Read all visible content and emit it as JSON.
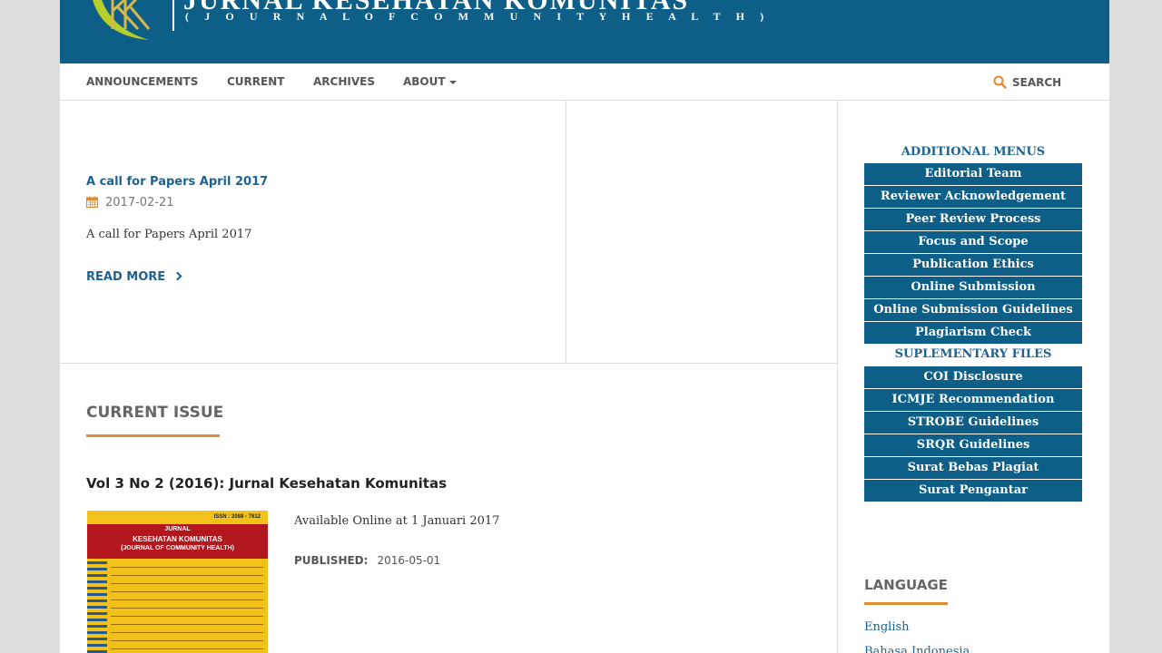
{
  "header": {
    "title": "JURNAL KESEHATAN KOMUNITAS",
    "subtitle": "( J O U R N A L   O F   C O M M U N I T Y   H E A L T H )"
  },
  "nav": {
    "announcements": "ANNOUNCEMENTS",
    "current": "CURRENT",
    "archives": "ARCHIVES",
    "about": "ABOUT",
    "search": "SEARCH"
  },
  "announcement": {
    "title": "A call for Papers April 2017",
    "date": "2017-02-21",
    "summary": "A call for Papers April 2017",
    "read_more": "READ MORE"
  },
  "current_issue": {
    "heading": "CURRENT ISSUE",
    "title": "Vol 3 No 2 (2016): Jurnal Kesehatan Komunitas",
    "description": "Available Online at 1 Januari 2017",
    "published_label": "PUBLISHED:",
    "published_date": "2016-05-01",
    "cover": {
      "issn": "ISSN : 2088 - 7612",
      "line1": "JURNAL",
      "line2": "KESEHATAN KOMUNITAS",
      "line3": "(JOURNAL OF COMMUNITY HEALTH)"
    }
  },
  "sidebar": {
    "additional_heading": "ADDITIONAL MENUS",
    "additional": [
      "Editorial Team",
      "Reviewer Acknowledgement",
      "Peer Review Process",
      "Focus and Scope",
      "Publication Ethics",
      "Online Submission",
      "Online Submission Guidelines",
      "Plagiarism Check"
    ],
    "supplementary_heading": "SUPLEMENTARY FILES",
    "supplementary": [
      "COI Disclosure",
      "ICMJE Recommendation",
      "STROBE Guidelines",
      "SRQR Guidelines",
      "Surat Bebas Plagiat",
      "Surat Pengantar"
    ],
    "language_heading": "LANGUAGE",
    "languages": [
      "English",
      "Bahasa Indonesia"
    ]
  },
  "colors": {
    "brand": "#0e5f88",
    "accent": "#e08a33",
    "link": "#1e6292"
  },
  "icons": {
    "search": "search-icon",
    "calendar": "calendar-icon",
    "read_more": "chevron-right-icon",
    "dropdown": "caret-down-icon"
  }
}
